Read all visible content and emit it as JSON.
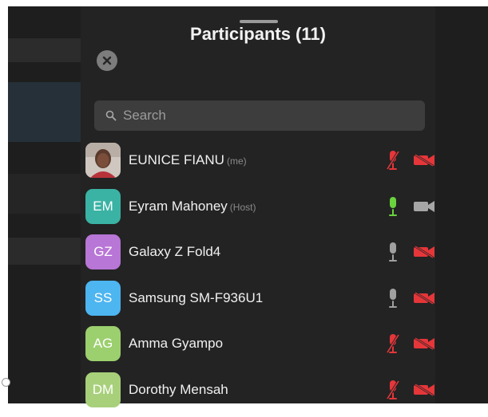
{
  "title": "Participants (11)",
  "search": {
    "placeholder": "Search"
  },
  "icons": {
    "close": "close-icon",
    "search": "search-icon",
    "mic_on": "mic-icon",
    "mic_off": "mic-off-icon",
    "cam_on": "video-camera-icon",
    "cam_off": "video-camera-off-icon"
  },
  "colors": {
    "panel": "#232323",
    "search_bg": "#3d3d3d",
    "muted_red": "#e5363a",
    "mic_on_green": "#6ad33e",
    "idle_gray": "#9c9c9c"
  },
  "participants": [
    {
      "name": "EUNICE FIANU",
      "tag": "(me)",
      "initials": "",
      "photo": true,
      "avatar_color": "#6b5a4e",
      "mic": "off",
      "cam": "off"
    },
    {
      "name": "Eyram Mahoney",
      "tag": "(Host)",
      "initials": "EM",
      "photo": false,
      "avatar_color": "#3ab3a4",
      "mic": "on",
      "cam": "on"
    },
    {
      "name": "Galaxy Z Fold4",
      "tag": "",
      "initials": "GZ",
      "photo": false,
      "avatar_color": "#b876d6",
      "mic": "idle",
      "cam": "off"
    },
    {
      "name": "Samsung SM-F936U1",
      "tag": "",
      "initials": "SS",
      "photo": false,
      "avatar_color": "#4db5f0",
      "mic": "idle",
      "cam": "off"
    },
    {
      "name": "Amma Gyampo",
      "tag": "",
      "initials": "AG",
      "photo": false,
      "avatar_color": "#9ccf6e",
      "mic": "off",
      "cam": "off"
    },
    {
      "name": "Dorothy Mensah",
      "tag": "",
      "initials": "DM",
      "photo": false,
      "avatar_color": "#a8d07a",
      "mic": "off",
      "cam": "off"
    }
  ]
}
